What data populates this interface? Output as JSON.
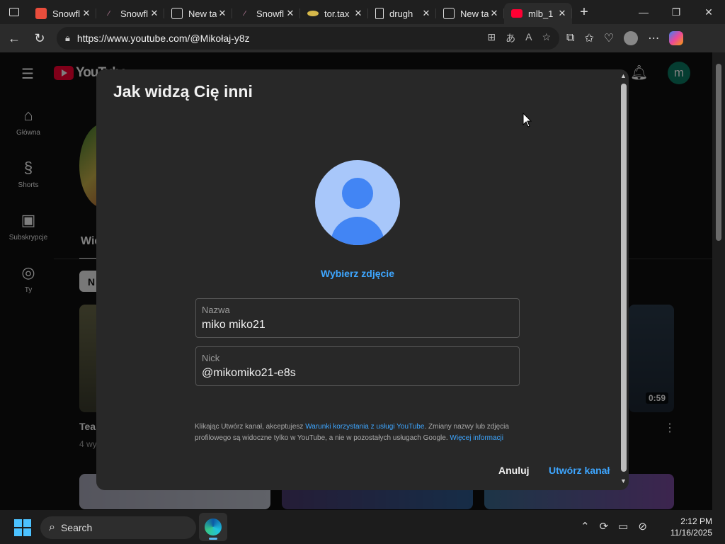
{
  "browser": {
    "tabs": [
      {
        "title": "Snowfl",
        "favicon": "snowfl-icon"
      },
      {
        "title": "Snowfl",
        "favicon": "snowfl-icon"
      },
      {
        "title": "New ta",
        "favicon": "newtab-icon"
      },
      {
        "title": "Snowfl",
        "favicon": "snowfl-icon"
      },
      {
        "title": "tor.tax",
        "favicon": "tor-icon"
      },
      {
        "title": "drugh",
        "favicon": "doc-icon"
      },
      {
        "title": "New ta",
        "favicon": "newtab-icon"
      },
      {
        "title": "mlb_1",
        "favicon": "youtube-icon",
        "active": true
      }
    ],
    "url": "https://www.youtube.com/@Mikołaj-y8z"
  },
  "youtube": {
    "logo_text": "YouTube",
    "avatar_letter": "m",
    "sidebar": [
      {
        "label": "Główna",
        "icon": "home-icon"
      },
      {
        "label": "Shorts",
        "icon": "shorts-icon"
      },
      {
        "label": "Subskrypcje",
        "icon": "subscriptions-icon"
      },
      {
        "label": "Ty",
        "icon": "you-icon"
      }
    ],
    "bg_tab_label": "Wid",
    "bg_chip": "N",
    "bg_video_title": "Tea",
    "bg_video_meta": "4 wy",
    "bg_duration": "0:59"
  },
  "dialog": {
    "title": "Jak widzą Cię inni",
    "choose_photo": "Wybierz zdjęcie",
    "name_label": "Nazwa",
    "name_value": "miko miko21",
    "handle_label": "Nick",
    "handle_value": "@mikomiko21-e8s",
    "legal_prefix": "Klikając Utwórz kanał, akceptujesz ",
    "legal_link": "Warunki korzystania z usługi YouTube",
    "legal_middle": ". Zmiany nazwy lub zdjęcia profilowego są widoczne tylko w YouTube, a nie w pozostałych usługach Google. ",
    "legal_more": "Więcej informacji",
    "cancel": "Anuluj",
    "create": "Utwórz kanał"
  },
  "taskbar": {
    "search_placeholder": "Search",
    "time": "2:12 PM",
    "date": "11/16/2025"
  },
  "colors": {
    "accent_blue": "#3ea6ff",
    "youtube_red": "#ff0033",
    "dialog_bg": "#282828"
  }
}
